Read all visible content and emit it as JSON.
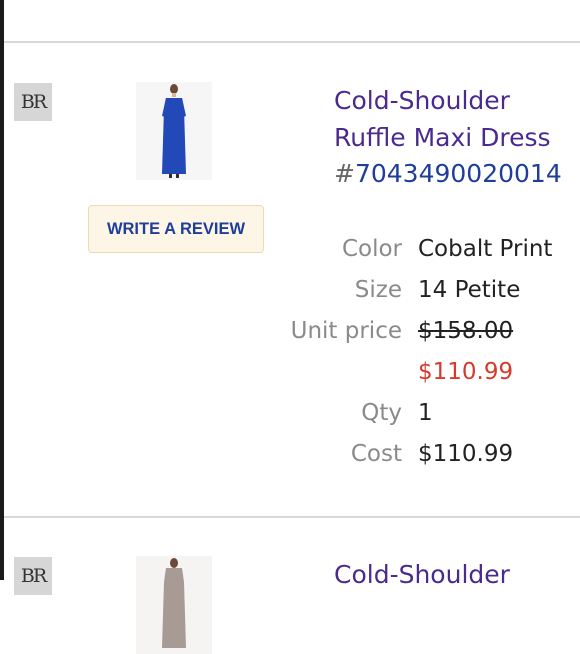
{
  "items": [
    {
      "brand_mark": "BR",
      "brand_icon": "banana-republic-logo",
      "title_line1": "Cold-Shoulder",
      "title_line2": "Ruffle Maxi Dress",
      "sku_prefix": "#",
      "sku_number": "7043490020014",
      "review_button": "WRITE A REVIEW",
      "labels": {
        "color": "Color",
        "size": "Size",
        "unit_price": "Unit price",
        "qty": "Qty",
        "cost": "Cost"
      },
      "color": "Cobalt Print",
      "size": "14 Petite",
      "original_price": "$158.00",
      "sale_price": "$110.99",
      "qty": "1",
      "cost": "$110.99",
      "dress_color": "#2348b8"
    },
    {
      "brand_mark": "BR",
      "brand_icon": "banana-republic-logo",
      "title_line1": "Cold-Shoulder"
    }
  ],
  "colors": {
    "link": "#4b2a8f",
    "sku": "#1f3e9c",
    "sale": "#d63a2a"
  }
}
